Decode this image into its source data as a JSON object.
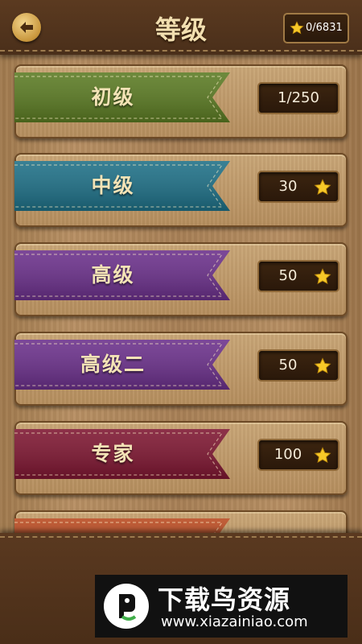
{
  "header": {
    "title": "等级",
    "stars": "0/6831"
  },
  "levels": [
    {
      "name": "初级",
      "value": "1/250",
      "star": false,
      "color": "#5a7a22"
    },
    {
      "name": "中级",
      "value": "30",
      "star": true,
      "color": "#1d6f86"
    },
    {
      "name": "高级",
      "value": "50",
      "star": true,
      "color": "#6a2f8a"
    },
    {
      "name": "高级二",
      "value": "50",
      "star": true,
      "color": "#6a2f8a"
    },
    {
      "name": "专家",
      "value": "100",
      "star": true,
      "color": "#7d1530"
    },
    {
      "name": "",
      "value": "",
      "star": false,
      "color": "#b8481e"
    }
  ],
  "watermark": {
    "title": "下载鸟资源",
    "url": "www.xiazainiao.com"
  },
  "icons": {
    "back": "back-arrow-icon",
    "star": "star-icon"
  }
}
